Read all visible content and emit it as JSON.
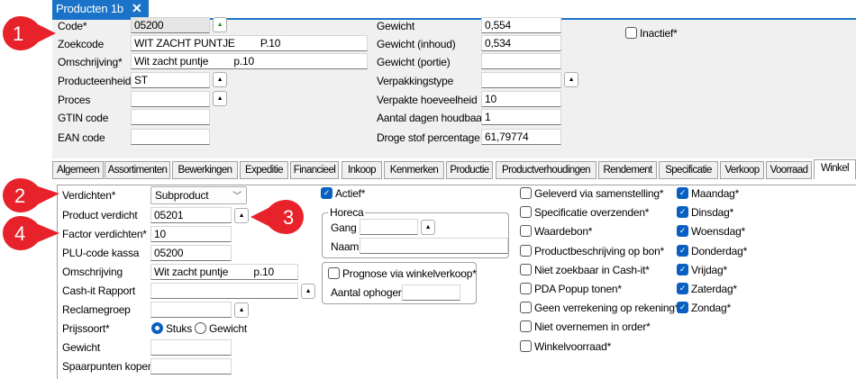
{
  "window": {
    "tab_title": "Producten 1b",
    "close_icon": "close-icon"
  },
  "header": {
    "left": [
      {
        "label": "Code*",
        "value": "05200",
        "button": "green-up-arrow"
      },
      {
        "label": "Zoekcode",
        "value": "WIT ZACHT PUNTJE         P.10"
      },
      {
        "label": "Omschrijving*",
        "value": "Wit zacht puntje         p.10"
      },
      {
        "label": "Producteenheid",
        "value": "ST",
        "button": "up-arrow"
      },
      {
        "label": "Proces",
        "value": "",
        "button": "up-arrow"
      },
      {
        "label": "GTIN code",
        "value": ""
      },
      {
        "label": "EAN code",
        "value": ""
      }
    ],
    "right": [
      {
        "label": "Gewicht",
        "value": "0,554"
      },
      {
        "label": "Gewicht (inhoud)",
        "value": "0,534"
      },
      {
        "label": "Gewicht (portie)",
        "value": ""
      },
      {
        "label": "Verpakkingstype",
        "value": ""
      },
      {
        "label": "Verpakte hoeveelheid",
        "value": "10"
      },
      {
        "label": "Aantal dagen houdbaar",
        "value": "1"
      },
      {
        "label": "Droge stof percentage",
        "value": "61,79774"
      }
    ],
    "inactief": {
      "label": "Inactief*",
      "checked": false
    }
  },
  "tabs": [
    "Algemeen",
    "Assortimenten",
    "Bewerkingen",
    "Expeditie",
    "Financieel",
    "Inkoop",
    "Kenmerken",
    "Productie",
    "Productverhoudingen",
    "Rendement",
    "Specificatie",
    "Verkoop",
    "Voorraad",
    "Winkel"
  ],
  "active_tab": "Winkel",
  "winkel": {
    "verdichten": {
      "label": "Verdichten*",
      "value": "Subproduct"
    },
    "product_verdicht": {
      "label": "Product verdicht",
      "value": "05201"
    },
    "factor_verdichten": {
      "label": "Factor verdichten*",
      "value": "10"
    },
    "plu_code": {
      "label": "PLU-code kassa",
      "value": "05200"
    },
    "omschrijving": {
      "label": "Omschrijving",
      "value": "Wit zacht puntje         p.10"
    },
    "cashit_rapport": {
      "label": "Cash-it Rapport",
      "value": ""
    },
    "reclamegroep": {
      "label": "Reclamegroep",
      "value": ""
    },
    "prijssoort": {
      "label": "Prijssoort*",
      "options": [
        "Stuks",
        "Gewicht"
      ],
      "selected": "Stuks"
    },
    "gewicht": {
      "label": "Gewicht",
      "value": ""
    },
    "spaarpunten": {
      "label": "Spaarpunten kopen",
      "value": ""
    },
    "actief": {
      "label": "Actief*",
      "checked": true
    },
    "horeca": {
      "title": "Horeca",
      "gang_label": "Gang",
      "gang_value": "",
      "naam_label": "Naam",
      "naam_value": ""
    },
    "prognose": {
      "label": "Prognose via winkelverkoop*",
      "checked": false,
      "aantal_label": "Aantal ophogen",
      "aantal_value": ""
    },
    "options": [
      {
        "label": "Geleverd via samenstelling*",
        "checked": false
      },
      {
        "label": "Specificatie overzenden*",
        "checked": false
      },
      {
        "label": "Waardebon*",
        "checked": false
      },
      {
        "label": "Productbeschrijving op bon*",
        "checked": false
      },
      {
        "label": "Niet zoekbaar in Cash-it*",
        "checked": false
      },
      {
        "label": "PDA Popup tonen*",
        "checked": false
      },
      {
        "label": "Geen verrekening op rekening*",
        "checked": false
      },
      {
        "label": "Niet overnemen in order*",
        "checked": false
      },
      {
        "label": "Winkelvoorraad*",
        "checked": false
      }
    ],
    "days": [
      {
        "label": "Maandag*",
        "checked": true
      },
      {
        "label": "Dinsdag*",
        "checked": true
      },
      {
        "label": "Woensdag*",
        "checked": true
      },
      {
        "label": "Donderdag*",
        "checked": true
      },
      {
        "label": "Vrijdag*",
        "checked": true
      },
      {
        "label": "Zaterdag*",
        "checked": true
      },
      {
        "label": "Zondag*",
        "checked": true
      }
    ]
  },
  "callouts": [
    "1",
    "2",
    "3",
    "4"
  ],
  "colors": {
    "accent": "#1a73c8",
    "checkbox": "#0a5fc2",
    "callout": "#e8222a"
  }
}
